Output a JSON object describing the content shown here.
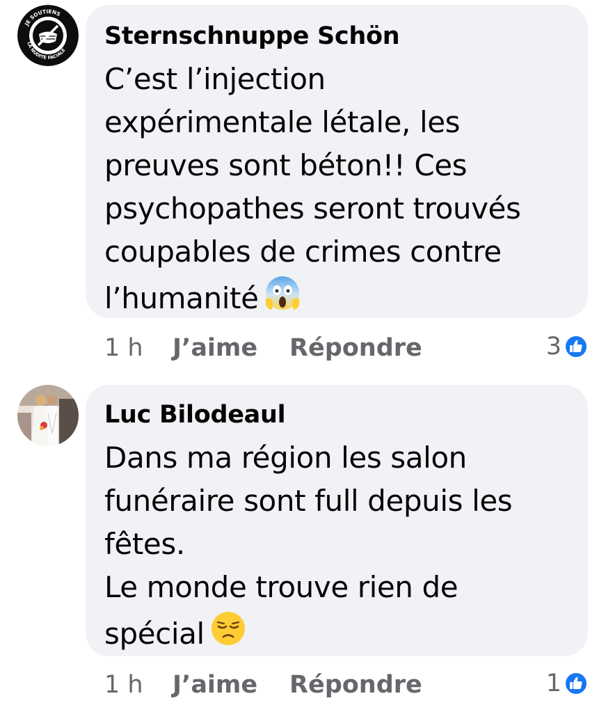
{
  "comments": [
    {
      "author": "Sternschnuppe Schön",
      "avatar_icon": "masked-badge-icon",
      "avatar_badge_text_top": "JE SOUTIENS",
      "avatar_badge_text_bottom": "LA NUDITE FACIALE",
      "lines": [
        "C’est l’injection",
        "expérimentale létale, les",
        "preuves sont béton!! Ces",
        "psychopathes seront trouvés",
        "coupables de crimes contre",
        "l’humanité"
      ],
      "end_emoji": "screaming-face-emoji",
      "time": "1 h",
      "like_label": "J’aime",
      "reply_label": "Répondre",
      "reaction_count": "3",
      "reaction_icon": "like-thumb-icon"
    },
    {
      "author": "Luc Bilodeaul",
      "avatar_icon": "wedding-photo-avatar",
      "lines": [
        "Dans ma région les salon",
        "funéraire sont full depuis les",
        "fêtes.",
        "Le monde trouve rien de",
        "spécial"
      ],
      "end_emoji": "pensive-face-emoji",
      "time": "1 h",
      "like_label": "J’aime",
      "reply_label": "Répondre",
      "reaction_count": "1",
      "reaction_icon": "like-thumb-icon"
    }
  ],
  "colors": {
    "bubble": "#f0f2f5",
    "text": "#050505",
    "secondary": "#65676b",
    "like_blue": "#1877f2"
  }
}
